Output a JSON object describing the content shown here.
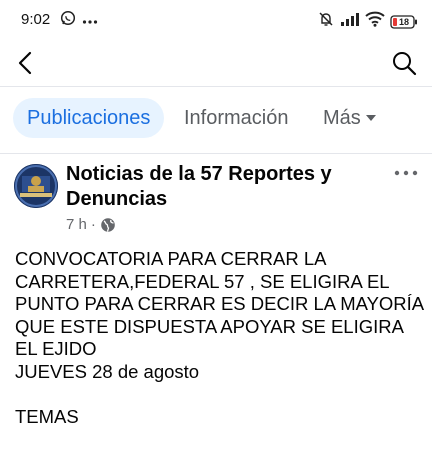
{
  "status_bar": {
    "time": "9:02",
    "left_icons": [
      "whatsapp-icon",
      "more-dots-icon"
    ],
    "right_icons": [
      "mute-icon",
      "signal-icon",
      "wifi-icon",
      "battery-icon"
    ],
    "battery_level": "18",
    "battery_color": "#e53935"
  },
  "top_bar": {
    "back_icon": "chevron-left-icon",
    "search_icon": "search-icon"
  },
  "tabs": {
    "items": [
      {
        "label": "Publicaciones",
        "active": true
      },
      {
        "label": "Información",
        "active": false
      },
      {
        "label": "Más",
        "active": false
      }
    ],
    "accent": "#1b6fe0",
    "active_bg": "#e7f3ff"
  },
  "post": {
    "page_name": "Noticias de la 57 Reportes y Denuncias",
    "time_ago": "7 h",
    "separator": "·",
    "audience_icon": "globe-icon",
    "body": "CONVOCATORIA PARA CERRAR LA CARRETERA,FEDERAL 57 , SE ELIGIRA EL PUNTO PARA CERRAR  ES DECIR LA MAYORÍA QUE ESTE DISPUESTA APOYAR SE ELIGIRA EL EJIDO\nJUEVES 28 de agosto\n\nTEMAS"
  }
}
